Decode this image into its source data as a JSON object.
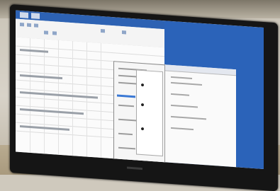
{
  "scene": {
    "description_colors": {
      "desk": "#b3a488",
      "bezel": "#151515",
      "screen_blue": "#2b63b9",
      "screen_white": "#eef0f4"
    },
    "icons": [
      "monitor-bezel",
      "spreadsheet-window",
      "dialog-window",
      "list-panel"
    ]
  }
}
